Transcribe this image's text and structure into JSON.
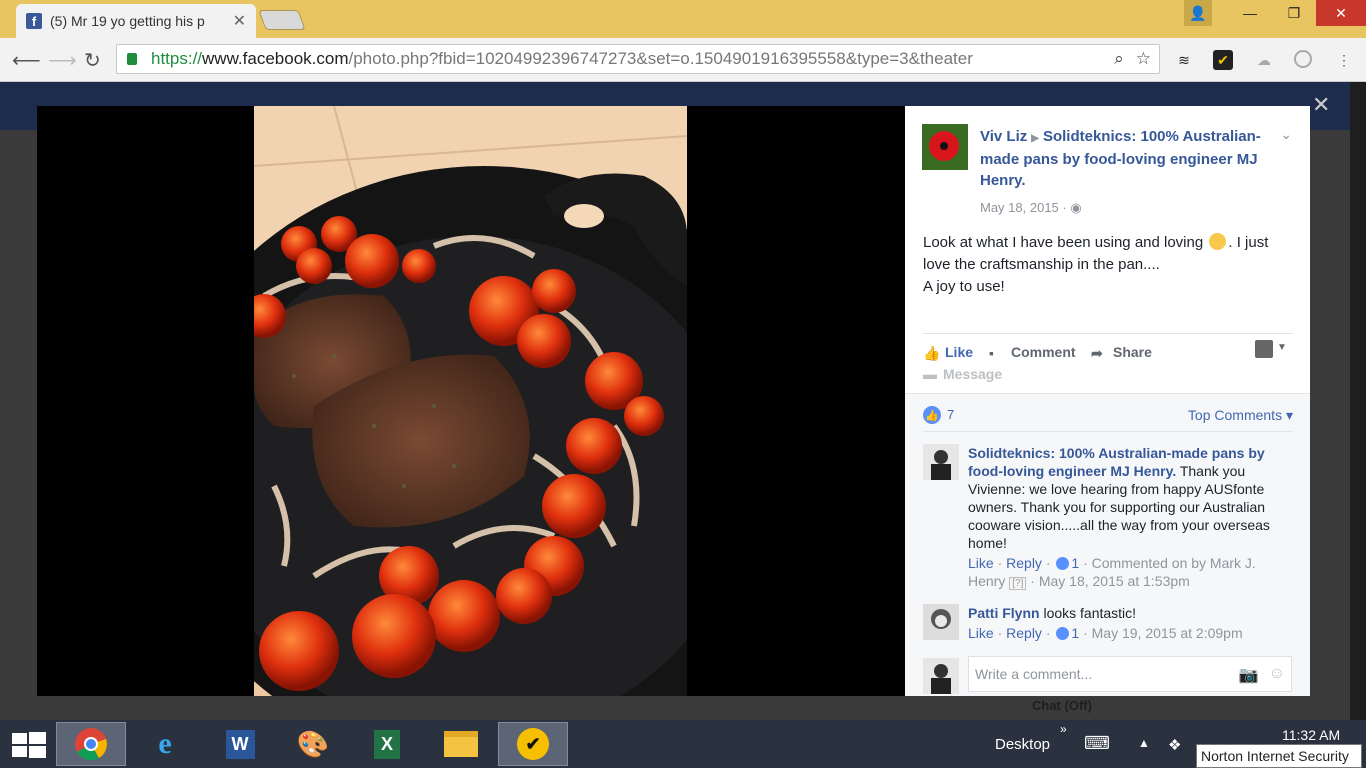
{
  "browser": {
    "tab_title": "(5) Mr 19 yo getting his p",
    "favicon_letter": "f",
    "url_scheme": "https://",
    "url_host": "www.facebook.com",
    "url_path": "/photo.php?fbid=10204992396747273&set=o.1504901916395558&type=3&theater"
  },
  "post": {
    "author": "Viv Liz",
    "target_page": "Solidteknics: 100% Australian-made pans by food-loving engineer MJ Henry.",
    "date": "May 18, 2015",
    "text_part1": "Look at what I have been using and loving",
    "text_part2": ". I just love the craftsmanship in the pan....",
    "text_part3": "A joy to use!",
    "actions": {
      "like": "Like",
      "comment": "Comment",
      "share": "Share",
      "message": "Message"
    },
    "reaction_count": "7",
    "sort_label": "Top Comments"
  },
  "comments": [
    {
      "name": "Solidteknics: 100% Australian-made pans by food-loving engineer MJ Henry.",
      "text": " Thank you Vivienne: we love hearing from happy AUSfonte owners. Thank you for supporting our Australian cooware vision.....all the way from your overseas home!",
      "like": "Like",
      "reply": "Reply",
      "likes": "1",
      "meta": "Commented on by Mark J. Henry",
      "badge": "[?]",
      "time": "May 18, 2015 at 1:53pm"
    },
    {
      "name": "Patti Flynn",
      "text": " looks fantastic!",
      "like": "Like",
      "reply": "Reply",
      "likes": "1",
      "time": "May 19, 2015 at 2:09pm"
    }
  ],
  "composer": {
    "placeholder": "Write a comment..."
  },
  "page_behind": {
    "chat_status": "Chat (Off)"
  },
  "taskbar": {
    "desktop_label": "Desktop",
    "time": "11:32 AM",
    "tooltip": "Norton Internet Security"
  },
  "colors": {
    "fb_blue": "#365899",
    "link_blue": "#4267b2",
    "taskbar": "#2a3240",
    "tabbar": "#e8c560"
  }
}
